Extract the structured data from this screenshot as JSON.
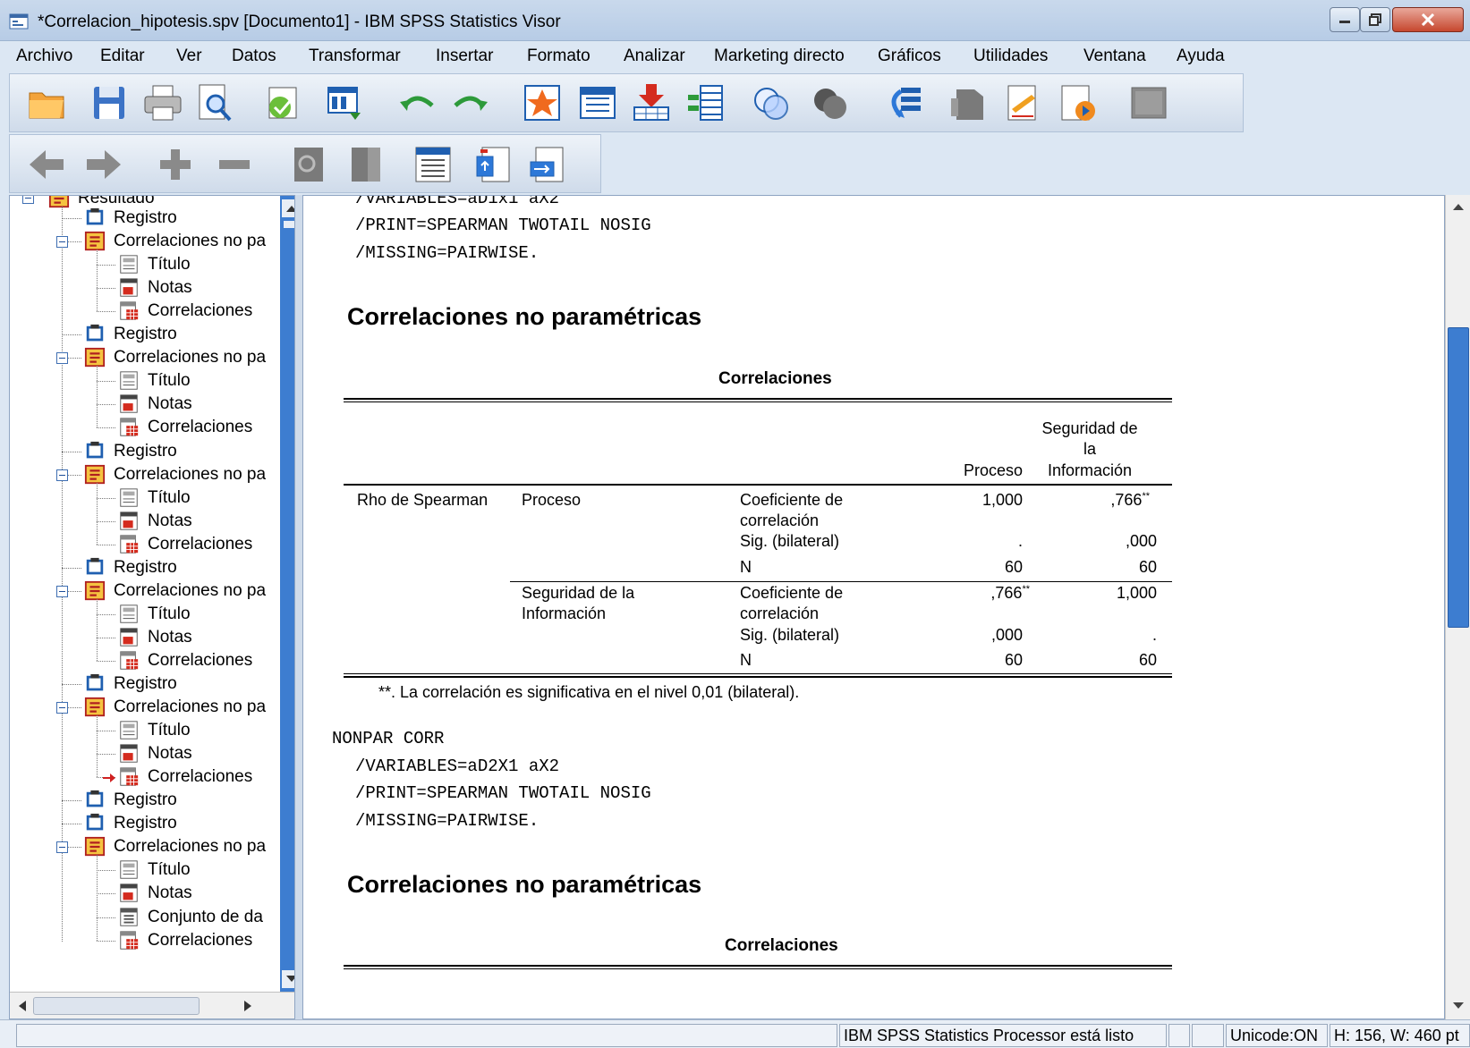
{
  "window": {
    "title": "*Correlacion_hipotesis.spv [Documento1] - IBM SPSS Statistics Visor",
    "controls": [
      "minimize",
      "maximize",
      "close"
    ]
  },
  "menu": [
    "Archivo",
    "Editar",
    "Ver",
    "Datos",
    "Transformar",
    "Insertar",
    "Formato",
    "Analizar",
    "Marketing directo",
    "Gráficos",
    "Utilidades",
    "Ventana",
    "Ayuda"
  ],
  "toolbar1_icons": [
    "open-icon",
    "save-icon",
    "print-icon",
    "print-preview-icon",
    "export-icon",
    "recall-dialog-icon",
    "undo-icon",
    "redo-icon",
    "goto-case-icon",
    "goto-variable-icon",
    "insert-cases-icon",
    "insert-variable-icon",
    "split-file-icon",
    "weight-cases-icon",
    "select-cases-icon",
    "value-labels-icon",
    "use-sets-icon",
    "designate-window-icon",
    "run-script-icon",
    "spelling-icon"
  ],
  "toolbar2_icons": [
    "promote-icon",
    "demote-icon",
    "expand-icon",
    "collapse-icon",
    "show-icon",
    "hide-icon",
    "insert-heading-icon",
    "insert-title-icon",
    "insert-text-icon"
  ],
  "outline": {
    "root": "Resultado",
    "items": [
      {
        "label": "Registro",
        "icon": "log-icon"
      },
      {
        "label": "Correlaciones no pa",
        "icon": "procedure-icon"
      },
      {
        "label": "Título",
        "icon": "title-icon"
      },
      {
        "label": "Notas",
        "icon": "notes-icon"
      },
      {
        "label": "Correlaciones",
        "icon": "table-icon"
      },
      {
        "label": "Registro",
        "icon": "log-icon"
      },
      {
        "label": "Correlaciones no pa",
        "icon": "procedure-icon"
      },
      {
        "label": "Título",
        "icon": "title-icon"
      },
      {
        "label": "Notas",
        "icon": "notes-icon"
      },
      {
        "label": "Correlaciones",
        "icon": "table-icon"
      },
      {
        "label": "Registro",
        "icon": "log-icon"
      },
      {
        "label": "Correlaciones no pa",
        "icon": "procedure-icon"
      },
      {
        "label": "Título",
        "icon": "title-icon"
      },
      {
        "label": "Notas",
        "icon": "notes-icon"
      },
      {
        "label": "Correlaciones",
        "icon": "table-icon"
      },
      {
        "label": "Registro",
        "icon": "log-icon"
      },
      {
        "label": "Correlaciones no pa",
        "icon": "procedure-icon"
      },
      {
        "label": "Título",
        "icon": "title-icon"
      },
      {
        "label": "Notas",
        "icon": "notes-icon"
      },
      {
        "label": "Correlaciones",
        "icon": "table-icon"
      },
      {
        "label": "Registro",
        "icon": "log-icon"
      },
      {
        "label": "Correlaciones no pa",
        "icon": "procedure-icon"
      },
      {
        "label": "Título",
        "icon": "title-icon"
      },
      {
        "label": "Notas",
        "icon": "notes-icon"
      },
      {
        "label": "Correlaciones",
        "icon": "table-icon",
        "current": true
      },
      {
        "label": "Registro",
        "icon": "log-icon"
      },
      {
        "label": "Registro",
        "icon": "log-icon"
      },
      {
        "label": "Correlaciones no pa",
        "icon": "procedure-icon"
      },
      {
        "label": "Título",
        "icon": "title-icon"
      },
      {
        "label": "Notas",
        "icon": "notes-icon"
      },
      {
        "label": "Conjunto de da",
        "icon": "dataset-icon"
      },
      {
        "label": "Correlaciones",
        "icon": "table-icon"
      }
    ]
  },
  "content": {
    "syntax_top": [
      "/VARIABLES=aD1x1 aX2",
      "/PRINT=SPEARMAN TWOTAIL NOSIG",
      "/MISSING=PAIRWISE."
    ],
    "heading1": "Correlaciones no paramétricas",
    "table": {
      "title": "Correlaciones",
      "col_headers": [
        "Proceso",
        "Seguridad de",
        "la",
        "Información"
      ],
      "rho": "Rho de Spearman",
      "var1": "Proceso",
      "var2_line1": "Seguridad de la",
      "var2_line2": "Información",
      "stat_coef_1": "Coeficiente de",
      "stat_coef_2": "correlación",
      "stat_sig": "Sig. (bilateral)",
      "stat_n": "N",
      "r1": {
        "coef_p": "1,000",
        "coef_s": ",766",
        "sig_p": ".",
        "sig_s": ",000",
        "n_p": "60",
        "n_s": "60"
      },
      "r2": {
        "coef_p": ",766",
        "coef_s": "1,000",
        "sig_p": ",000",
        "sig_s": ".",
        "n_p": "60",
        "n_s": "60"
      },
      "sig_mark": "**",
      "footnote": "**. La correlación es significativa en el nivel 0,01 (bilateral)."
    },
    "syntax_mid": [
      "NONPAR CORR",
      "/VARIABLES=aD2X1 aX2",
      "/PRINT=SPEARMAN TWOTAIL NOSIG",
      "/MISSING=PAIRWISE."
    ],
    "heading2": "Correlaciones no paramétricas",
    "table2_title": "Correlaciones"
  },
  "status": {
    "processor": "IBM SPSS Statistics Processor está listo",
    "unicode": "Unicode:ON",
    "dims": "H: 156, W: 460 pt"
  },
  "colors": {
    "scroll_blue": "#3d7dd0",
    "accent_red": "#d02020"
  }
}
